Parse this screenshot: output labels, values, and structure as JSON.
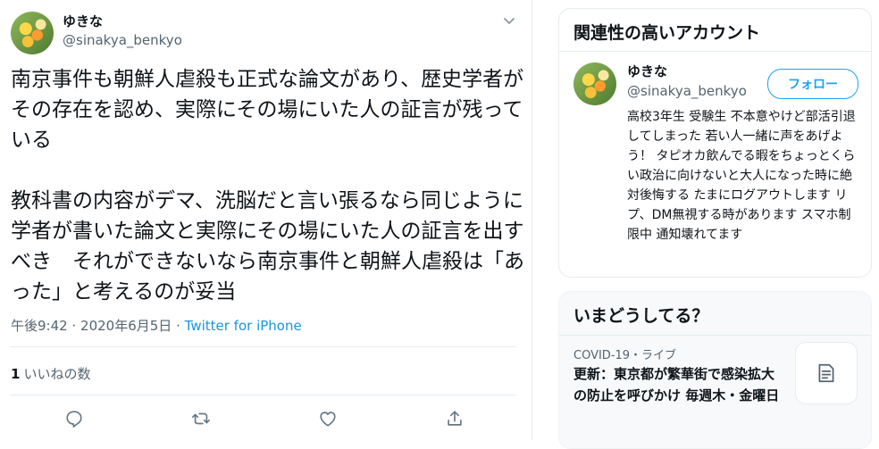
{
  "tweet": {
    "author_name": "ゆきな",
    "author_handle": "@sinakya_benkyo",
    "text": "南京事件も朝鮮人虐殺も正式な論文があり、歴史学者がその存在を認め、実際にその場にいた人の証言が残っている\n\n教科書の内容がデマ、洗脳だと言い張るなら同じように学者が書いた論文と実際にその場にいた人の証言を出すべき　それができないなら南京事件と朝鮮人虐殺は「あった」と考えるのが妥当",
    "time": "午後9:42",
    "date": "2020年6月5日",
    "separator": "·",
    "source": "Twitter for iPhone",
    "like_count": "1",
    "like_label": "いいねの数",
    "icons": [
      "chevron-down-icon",
      "reply-icon",
      "retweet-icon",
      "like-icon",
      "share-icon"
    ]
  },
  "related": {
    "title": "関連性の高いアカウント",
    "account": {
      "name": "ゆきな",
      "handle": "@sinakya_benkyo",
      "follow_label": "フォロー",
      "bio": "高校3年生 受験生 不本意やけど部活引退してしまった 若い人一緒に声をあげよう！ タピオカ飲んでる暇をちょっとくらい政治に向けないと大人になった時に絶対後悔する たまにログアウトします リプ、DM無視する時があります スマホ制限中 通知壊れてます"
    }
  },
  "trends": {
    "title": "いまどうしてる？",
    "item": {
      "meta": "COVID-19・ライブ",
      "headline": "更新：東京都が繁華街で感染拡大の防止を呼びかけ 毎週木・金曜日",
      "thumb_icon": "article-icon"
    }
  },
  "colors": {
    "accent": "#1da1f2",
    "link": "#1b95e0",
    "muted": "#536471",
    "border": "#e6ecf0"
  }
}
